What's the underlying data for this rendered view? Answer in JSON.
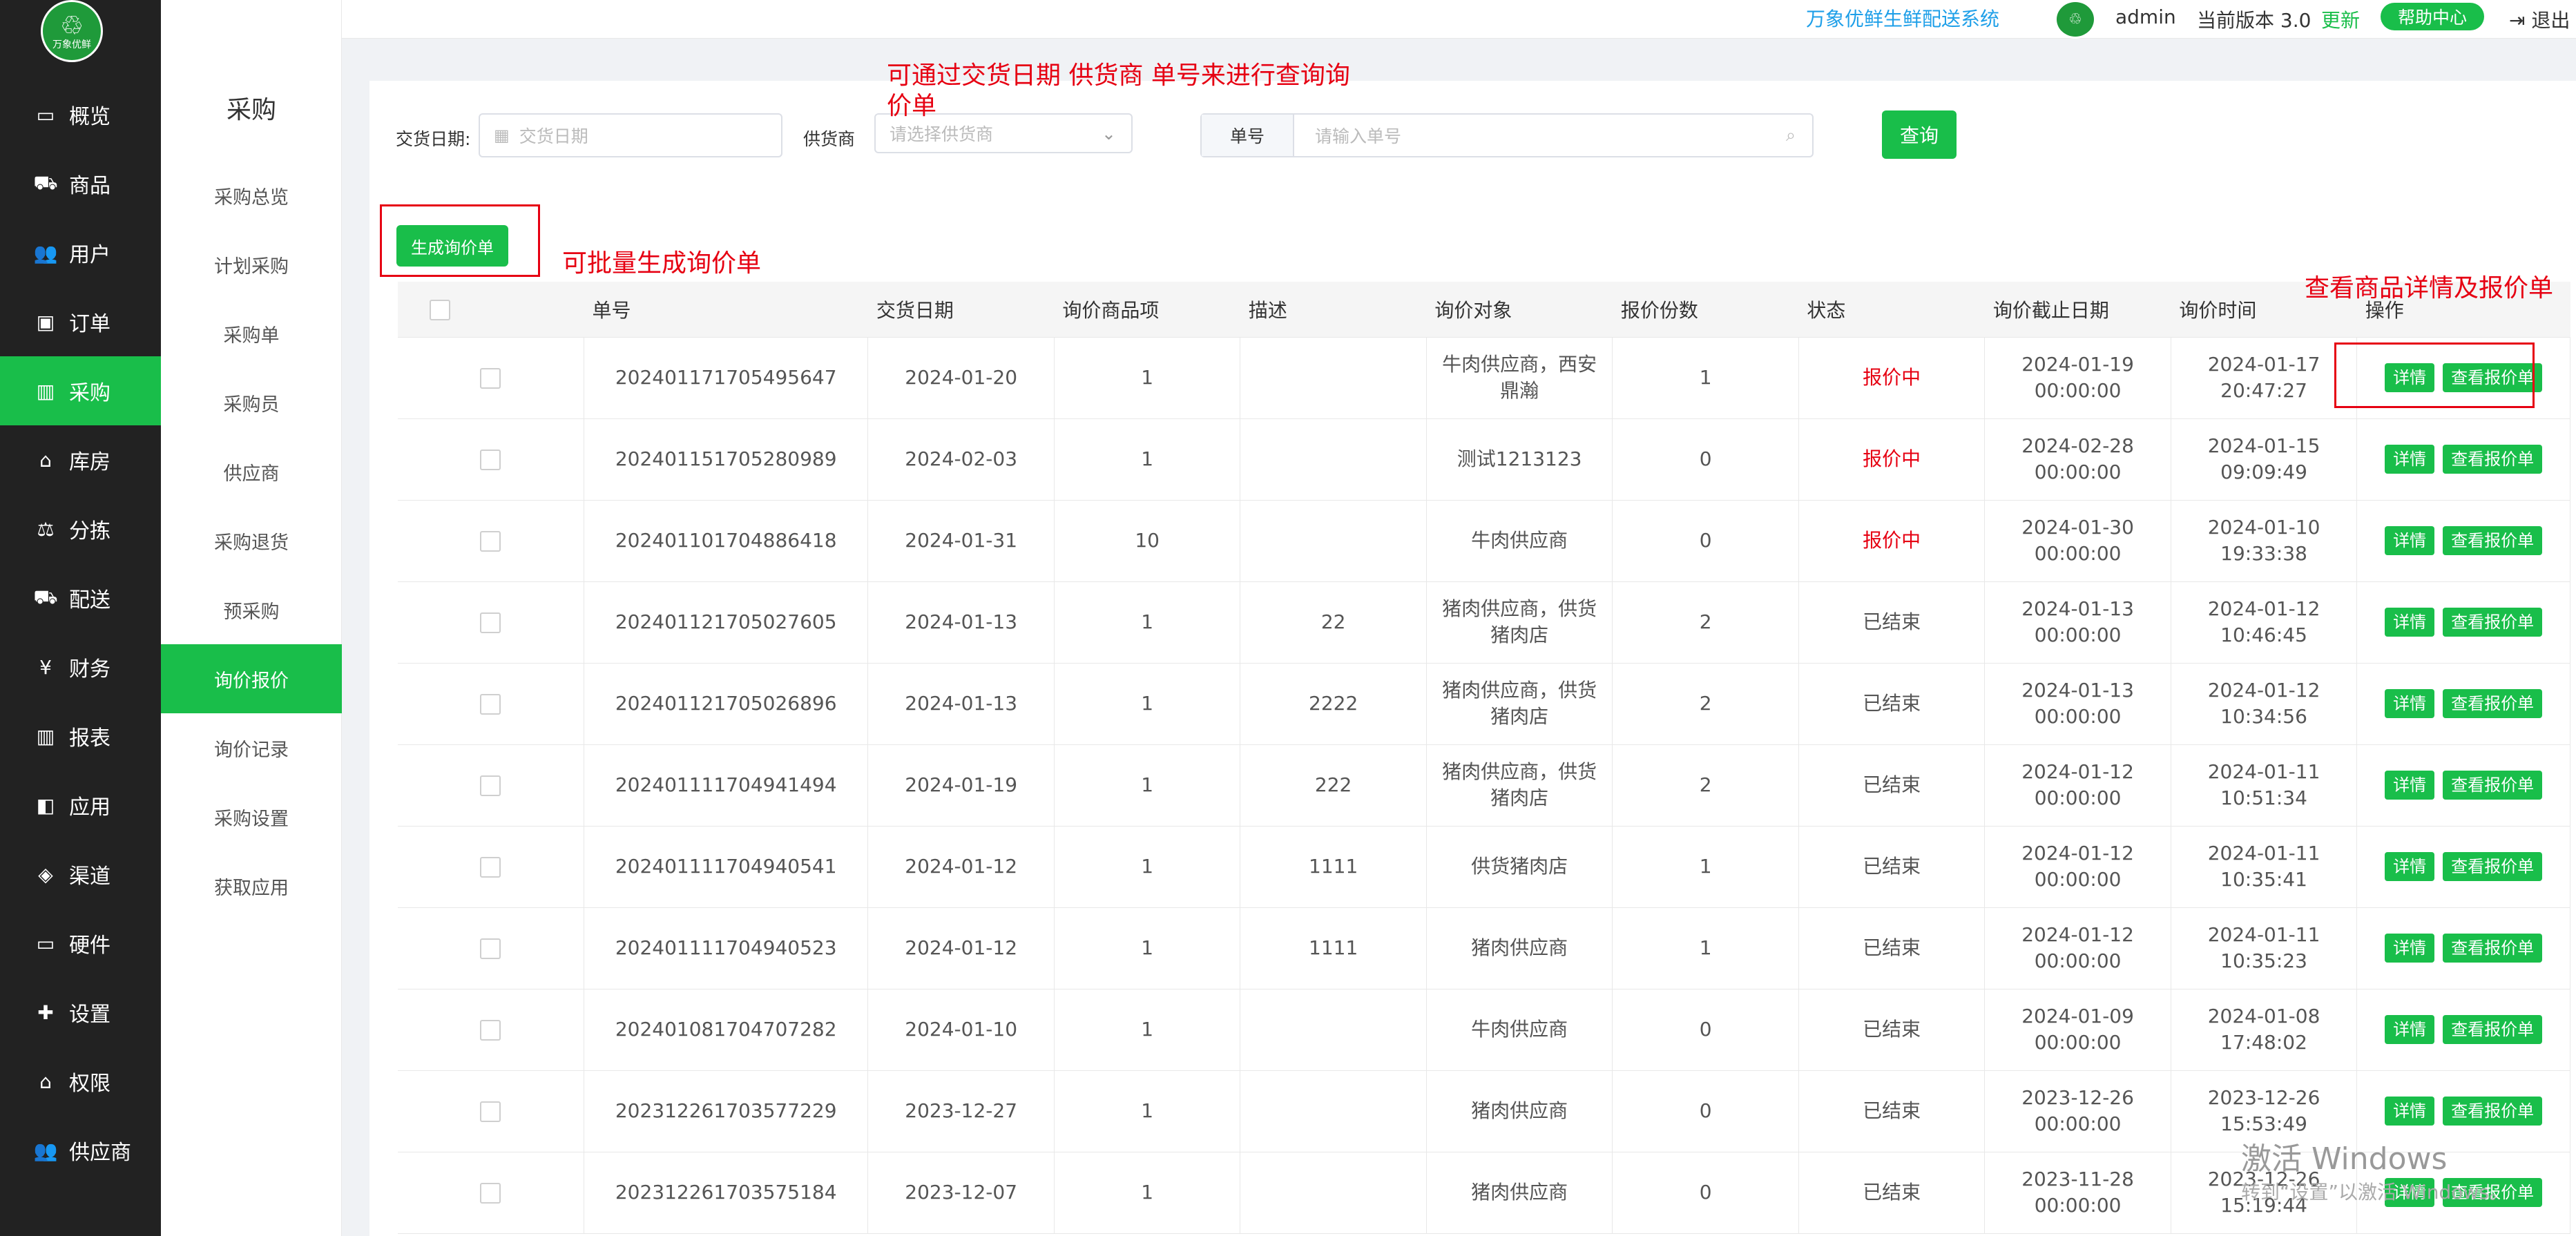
{
  "brand": {
    "logo_text": "万象优鲜"
  },
  "nav": [
    {
      "label": "概览",
      "icon": "monitor-icon"
    },
    {
      "label": "商品",
      "icon": "cart-icon"
    },
    {
      "label": "用户",
      "icon": "users-icon"
    },
    {
      "label": "订单",
      "icon": "order-icon"
    },
    {
      "label": "采购",
      "icon": "truck-bus-icon",
      "active": true
    },
    {
      "label": "库房",
      "icon": "home-icon"
    },
    {
      "label": "分拣",
      "icon": "scale-icon"
    },
    {
      "label": "配送",
      "icon": "truck-icon"
    },
    {
      "label": "财务",
      "icon": "yen-icon"
    },
    {
      "label": "报表",
      "icon": "bar-chart-icon"
    },
    {
      "label": "应用",
      "icon": "apps-icon"
    },
    {
      "label": "渠道",
      "icon": "cube-icon"
    },
    {
      "label": "硬件",
      "icon": "desktop-icon"
    },
    {
      "label": "设置",
      "icon": "puzzle-icon"
    },
    {
      "label": "权限",
      "icon": "bank-icon"
    },
    {
      "label": "供应商",
      "icon": "users-icon"
    }
  ],
  "subnav": {
    "title": "采购",
    "items": [
      "采购总览",
      "计划采购",
      "采购单",
      "采购员",
      "供应商",
      "采购退货",
      "预采购",
      "询价报价",
      "询价记录",
      "采购设置",
      "获取应用"
    ],
    "active_index": 7
  },
  "topbar": {
    "system_name": "万象优鲜生鲜配送系统",
    "user": "admin",
    "version_label": "当前版本",
    "version": "3.0",
    "update": "更新",
    "help": "帮助中心",
    "logout": "退出"
  },
  "filters": {
    "date_label": "交货日期:",
    "date_placeholder": "交货日期",
    "supplier_label": "供货商",
    "supplier_placeholder": "请选择供货商",
    "order_label": "单号",
    "order_placeholder": "请输入单号",
    "search_button": "查询"
  },
  "generate_button": "生成询价单",
  "annotations": {
    "filter_note": "可通过交货日期 供货商 单号来进行查询询价单",
    "batch_note": "可批量生成询价单",
    "detail_note": "查看商品详情及报价单"
  },
  "table": {
    "headers": [
      "单号",
      "交货日期",
      "询价商品项",
      "描述",
      "询价对象",
      "报价份数",
      "状态",
      "询价截止日期",
      "询价时间",
      "操作"
    ],
    "detail_btn": "详情",
    "quote_btn": "查看报价单",
    "rows": [
      {
        "no": "202401171705495647",
        "date": "2024-01-20",
        "items": "1",
        "desc": "",
        "target": "牛肉供应商，西安鼎瀚",
        "quotes": "1",
        "status": "报价中",
        "deadline": "2024-01-19 00:00:00",
        "time": "2024-01-17 20:47:27"
      },
      {
        "no": "202401151705280989",
        "date": "2024-02-03",
        "items": "1",
        "desc": "",
        "target": "测试1213123",
        "quotes": "0",
        "status": "报价中",
        "deadline": "2024-02-28 00:00:00",
        "time": "2024-01-15 09:09:49"
      },
      {
        "no": "202401101704886418",
        "date": "2024-01-31",
        "items": "10",
        "desc": "",
        "target": "牛肉供应商",
        "quotes": "0",
        "status": "报价中",
        "deadline": "2024-01-30 00:00:00",
        "time": "2024-01-10 19:33:38"
      },
      {
        "no": "202401121705027605",
        "date": "2024-01-13",
        "items": "1",
        "desc": "22",
        "target": "猪肉供应商，供货猪肉店",
        "quotes": "2",
        "status": "已结束",
        "deadline": "2024-01-13 00:00:00",
        "time": "2024-01-12 10:46:45"
      },
      {
        "no": "202401121705026896",
        "date": "2024-01-13",
        "items": "1",
        "desc": "2222",
        "target": "猪肉供应商，供货猪肉店",
        "quotes": "2",
        "status": "已结束",
        "deadline": "2024-01-13 00:00:00",
        "time": "2024-01-12 10:34:56"
      },
      {
        "no": "202401111704941494",
        "date": "2024-01-19",
        "items": "1",
        "desc": "222",
        "target": "猪肉供应商，供货猪肉店",
        "quotes": "2",
        "status": "已结束",
        "deadline": "2024-01-12 00:00:00",
        "time": "2024-01-11 10:51:34"
      },
      {
        "no": "202401111704940541",
        "date": "2024-01-12",
        "items": "1",
        "desc": "1111",
        "target": "供货猪肉店",
        "quotes": "1",
        "status": "已结束",
        "deadline": "2024-01-12 00:00:00",
        "time": "2024-01-11 10:35:41"
      },
      {
        "no": "202401111704940523",
        "date": "2024-01-12",
        "items": "1",
        "desc": "1111",
        "target": "猪肉供应商",
        "quotes": "1",
        "status": "已结束",
        "deadline": "2024-01-12 00:00:00",
        "time": "2024-01-11 10:35:23"
      },
      {
        "no": "202401081704707282",
        "date": "2024-01-10",
        "items": "1",
        "desc": "",
        "target": "牛肉供应商",
        "quotes": "0",
        "status": "已结束",
        "deadline": "2024-01-09 00:00:00",
        "time": "2024-01-08 17:48:02"
      },
      {
        "no": "202312261703577229",
        "date": "2023-12-27",
        "items": "1",
        "desc": "",
        "target": "猪肉供应商",
        "quotes": "0",
        "status": "已结束",
        "deadline": "2023-12-26 00:00:00",
        "time": "2023-12-26 15:53:49"
      },
      {
        "no": "202312261703575184",
        "date": "2023-12-07",
        "items": "1",
        "desc": "",
        "target": "猪肉供应商",
        "quotes": "0",
        "status": "已结束",
        "deadline": "2023-11-28 00:00:00",
        "time": "2023-12-26 15:19:44"
      }
    ]
  },
  "watermark": {
    "line1": "激活 Windows",
    "line2": "转到“设置”以激活 Windows。"
  }
}
